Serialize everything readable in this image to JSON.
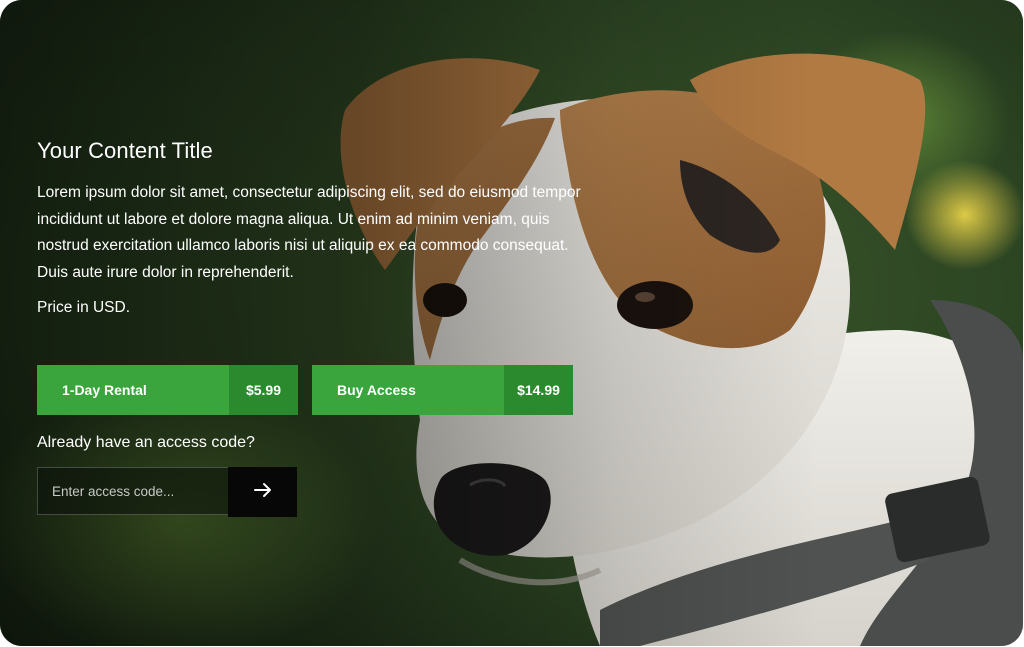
{
  "title": "Your Content Title",
  "description": "Lorem ipsum dolor sit amet, consectetur adipiscing elit, sed do eiusmod tempor incididunt ut labore et dolore magna aliqua. Ut enim ad minim veniam, quis nostrud exercitation ullamco laboris nisi ut aliquip ex ea commodo consequat. Duis aute irure dolor in reprehenderit.",
  "price_note": "Price in USD.",
  "offers": [
    {
      "label": "1-Day Rental",
      "price": "$5.99"
    },
    {
      "label": "Buy Access",
      "price": "$14.99"
    }
  ],
  "access_code": {
    "prompt": "Already have an access code?",
    "placeholder": "Enter access code...",
    "submit_icon": "arrow-right-icon"
  },
  "colors": {
    "button_primary": "#3aa53d",
    "button_price": "#2b8a2e",
    "submit_bg": "#070707"
  },
  "background_image": "photo of a brown and white terrier dog wearing a grey harness on a green blurred background"
}
